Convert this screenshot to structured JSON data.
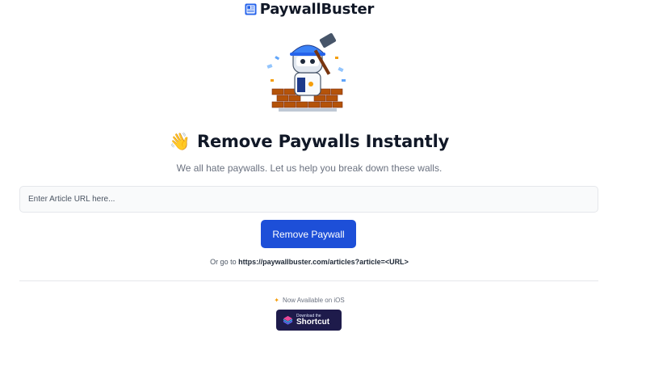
{
  "brand": {
    "name": "PaywallBuster",
    "icon": "newspaper-icon"
  },
  "hero": {
    "icon": "worker-breaking-wall-illustration"
  },
  "headline": {
    "emoji": "👋",
    "text": "Remove Paywalls Instantly"
  },
  "subtitle": "We all hate paywalls. Let us help you break down these walls.",
  "form": {
    "url_placeholder": "Enter Article URL here...",
    "url_value": "",
    "submit_label": "Remove Paywall",
    "button_color": "#1d4fd8"
  },
  "alt": {
    "prefix": "Or go to",
    "url": "https://paywallbuster.com/articles?article=<URL>"
  },
  "ios": {
    "icon": "sparkle-icon",
    "text": "Now Available on iOS",
    "shortcut_small": "Download the",
    "shortcut_big": "Shortcut",
    "shortcut_icon": "shortcuts-icon"
  }
}
